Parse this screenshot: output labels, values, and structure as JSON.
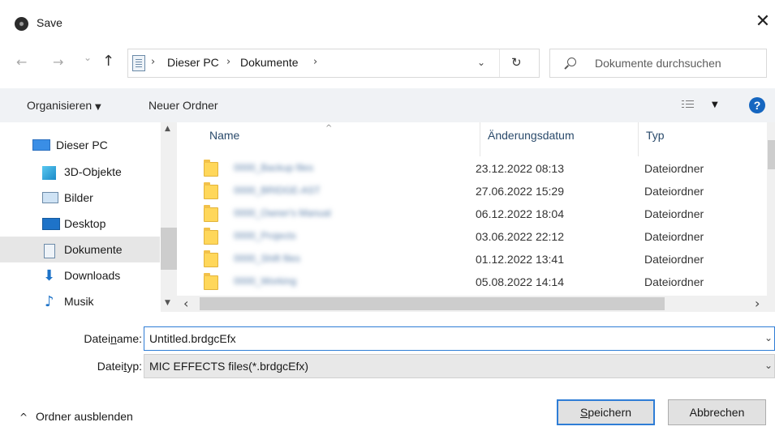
{
  "window": {
    "title": "Save",
    "close_glyph": "✕"
  },
  "nav": {
    "back_glyph": "←",
    "forward_glyph": "→",
    "recent_glyph": "⌄",
    "up_glyph": "↑"
  },
  "address": {
    "crumbs": [
      "Dieser PC",
      "Dokumente"
    ],
    "separator": "›",
    "dropdown_glyph": "⌄",
    "refresh_glyph": "↻"
  },
  "search": {
    "placeholder": "Dokumente durchsuchen"
  },
  "toolbar": {
    "organize": "Organisieren",
    "organize_caret": "▼",
    "new_folder": "Neuer Ordner",
    "view_caret": "▼",
    "help": "?"
  },
  "sidebar": {
    "items": [
      {
        "label": "Dieser PC",
        "icon": "computer-icon"
      },
      {
        "label": "3D-Objekte",
        "icon": "cube-3d-icon"
      },
      {
        "label": "Bilder",
        "icon": "pictures-icon"
      },
      {
        "label": "Desktop",
        "icon": "desktop-icon"
      },
      {
        "label": "Dokumente",
        "icon": "documents-icon",
        "selected": true
      },
      {
        "label": "Downloads",
        "icon": "downloads-icon"
      },
      {
        "label": "Musik",
        "icon": "music-icon"
      }
    ],
    "scroll_up": "▲",
    "scroll_down": "▼"
  },
  "filelist": {
    "columns": {
      "name": "Name",
      "sort_glyph": "^",
      "date": "Änderungsdatum",
      "type": "Typ"
    },
    "rows": [
      {
        "name": "0000_Backup files",
        "date": "23.12.2022 08:13",
        "type": "Dateiordner"
      },
      {
        "name": "0000_BRIDGE-AST",
        "date": "27.06.2022 15:29",
        "type": "Dateiordner"
      },
      {
        "name": "0000_Owner's Manual",
        "date": "06.12.2022 18:04",
        "type": "Dateiordner"
      },
      {
        "name": "0000_Projects",
        "date": "03.06.2022 22:12",
        "type": "Dateiordner"
      },
      {
        "name": "0000_Shift files",
        "date": "01.12.2022 13:41",
        "type": "Dateiordner"
      },
      {
        "name": "0000_Working",
        "date": "05.08.2022 14:14",
        "type": "Dateiordner"
      }
    ],
    "hscroll_left": "‹",
    "hscroll_right": "›"
  },
  "form": {
    "filename_label_pre": "Datei",
    "filename_label_u": "n",
    "filename_label_post": "ame:",
    "filename_value": "Untitled.brdgcEfx",
    "filetype_label_pre": "Datei",
    "filetype_label_u": "t",
    "filetype_label_post": "yp:",
    "filetype_value": "MIC EFFECTS files(*.brdgcEfx)",
    "dropdown_glyph": "⌄"
  },
  "footer": {
    "hide_folders_glyph": "^",
    "hide_folders": "Ordner ausblenden",
    "save_pre": "",
    "save_u": "S",
    "save_post": "peichern",
    "cancel": "Abbrechen"
  },
  "colors": {
    "accent": "#2f7dd6",
    "help": "#1566c0",
    "folder": "#ffd75a",
    "selected_bg": "#e6e6e6"
  }
}
